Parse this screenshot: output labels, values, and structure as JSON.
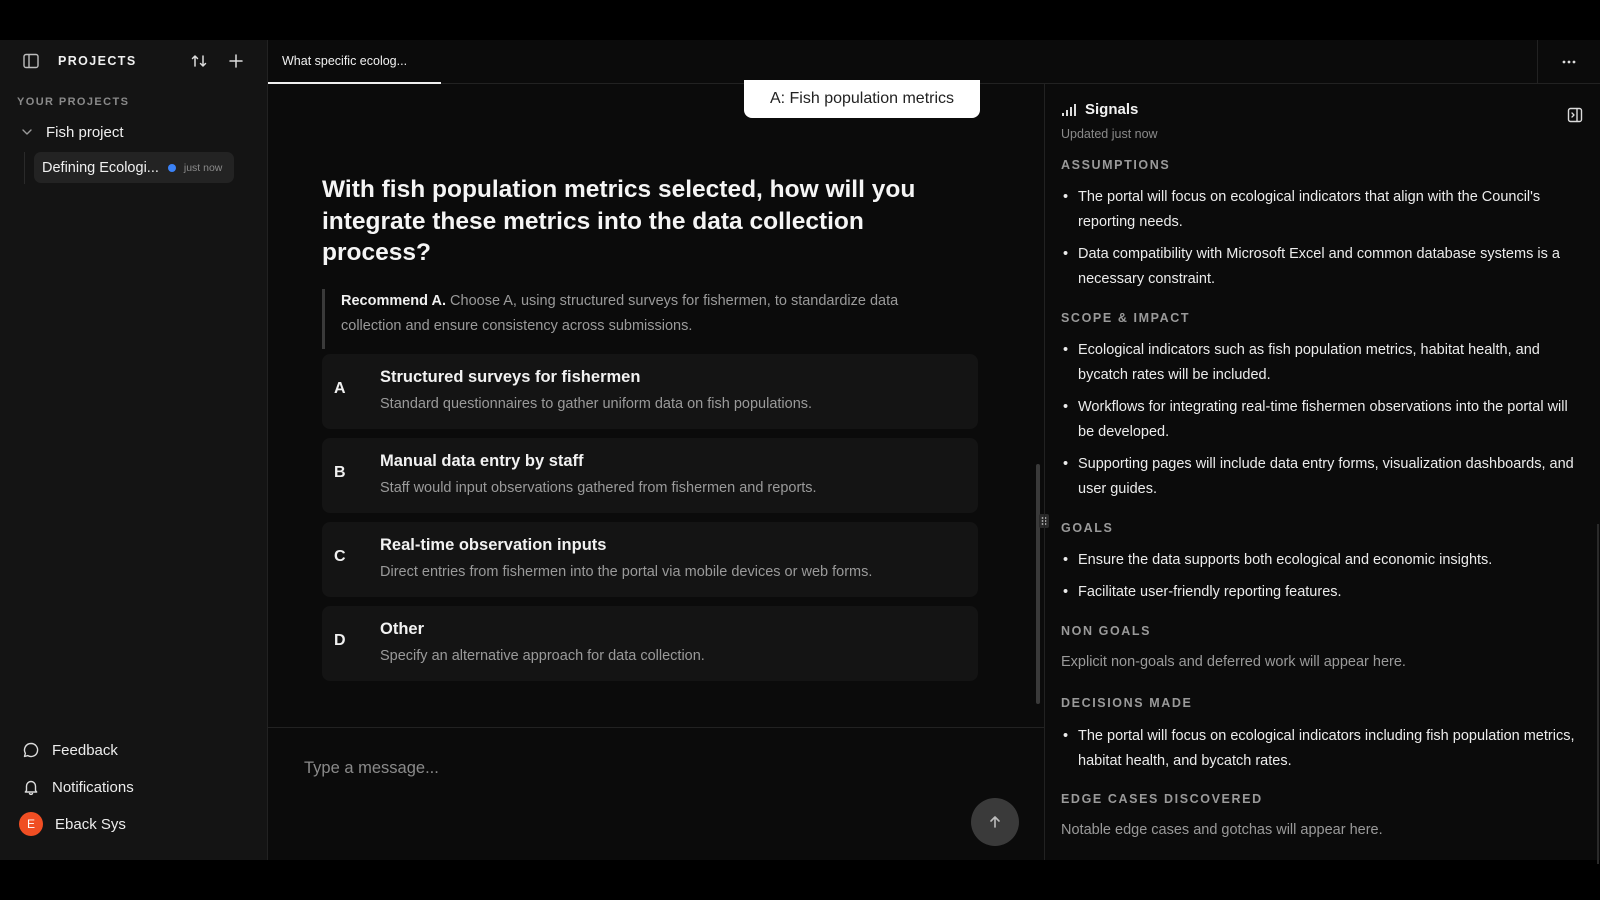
{
  "sidebar": {
    "title": "PROJECTS",
    "section_label": "YOUR PROJECTS",
    "project_name": "Fish project",
    "thread": {
      "name": "Defining Ecologi...",
      "time": "just now"
    },
    "footer": {
      "feedback": "Feedback",
      "notifications": "Notifications",
      "user_initial": "E",
      "user_name": "Eback Sys"
    }
  },
  "tabs": [
    {
      "label": "What specific ecolog..."
    }
  ],
  "chat": {
    "selected_answer": "A: Fish population metrics",
    "question": "With fish population metrics selected, how will you integrate these metrics into the data collection process?",
    "recommendation_lead": "Recommend A.",
    "recommendation_text": " Choose A, using structured surveys for fishermen, to standardize data collection and ensure consistency across submissions.",
    "options": [
      {
        "letter": "A",
        "title": "Structured surveys for fishermen",
        "desc": "Standard questionnaires to gather uniform data on fish populations."
      },
      {
        "letter": "B",
        "title": "Manual data entry by staff",
        "desc": "Staff would input observations gathered from fishermen and reports."
      },
      {
        "letter": "C",
        "title": "Real-time observation inputs",
        "desc": "Direct entries from fishermen into the portal via mobile devices or web forms."
      },
      {
        "letter": "D",
        "title": "Other",
        "desc": "Specify an alternative approach for data collection."
      }
    ],
    "composer_placeholder": "Type a message..."
  },
  "signals": {
    "title": "Signals",
    "updated": "Updated just now",
    "sections": {
      "assumptions": {
        "title": "ASSUMPTIONS",
        "items": [
          "The portal will focus on ecological indicators that align with the Council's reporting needs.",
          "Data compatibility with Microsoft Excel and common database systems is a necessary constraint."
        ]
      },
      "scope": {
        "title": "SCOPE & IMPACT",
        "items": [
          "Ecological indicators such as fish population metrics, habitat health, and bycatch rates will be included.",
          "Workflows for integrating real-time fishermen observations into the portal will be developed.",
          "Supporting pages will include data entry forms, visualization dashboards, and user guides."
        ]
      },
      "goals": {
        "title": "GOALS",
        "items": [
          "Ensure the data supports both ecological and economic insights.",
          "Facilitate user-friendly reporting features."
        ]
      },
      "non_goals": {
        "title": "NON GOALS",
        "placeholder": "Explicit non-goals and deferred work will appear here."
      },
      "decisions": {
        "title": "DECISIONS MADE",
        "items": [
          "The portal will focus on ecological indicators including fish population metrics, habitat health, and bycatch rates."
        ]
      },
      "edge_cases": {
        "title": "EDGE CASES DISCOVERED",
        "placeholder": "Notable edge cases and gotchas will appear here."
      }
    }
  },
  "colors": {
    "background": "#0b0b0b",
    "sidebar": "#141414",
    "accent_blue": "#3b82f6",
    "avatar": "#f04e23"
  }
}
